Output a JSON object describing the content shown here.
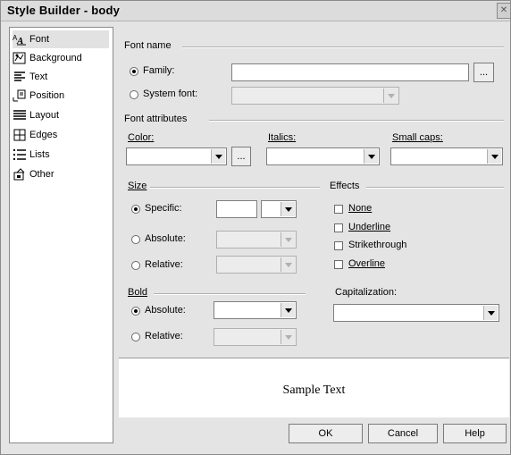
{
  "window": {
    "title": "Style Builder - body"
  },
  "nav": {
    "items": [
      {
        "label": "Font",
        "icon": "font-icon"
      },
      {
        "label": "Background",
        "icon": "background-icon"
      },
      {
        "label": "Text",
        "icon": "text-icon"
      },
      {
        "label": "Position",
        "icon": "position-icon"
      },
      {
        "label": "Layout",
        "icon": "layout-icon"
      },
      {
        "label": "Edges",
        "icon": "edges-icon"
      },
      {
        "label": "Lists",
        "icon": "lists-icon"
      },
      {
        "label": "Other",
        "icon": "other-icon"
      }
    ],
    "selected": "Font"
  },
  "font_name": {
    "header": "Font name",
    "family_label": "Family:",
    "family_value": "",
    "browse_label": "...",
    "system_font_label": "System font:",
    "system_font_value": ""
  },
  "font_attributes": {
    "header": "Font attributes",
    "color_label": "Color:",
    "color_browse_label": "...",
    "italics_label": "Italics:",
    "small_caps_label": "Small caps:"
  },
  "size": {
    "header": "Size",
    "specific_label": "Specific:",
    "absolute_label": "Absolute:",
    "relative_label": "Relative:"
  },
  "effects": {
    "header": "Effects",
    "none_label": "None",
    "underline_label": "Underline",
    "strikethrough_label": "Strikethrough",
    "overline_label": "Overline"
  },
  "bold": {
    "header": "Bold",
    "absolute_label": "Absolute:",
    "relative_label": "Relative:"
  },
  "capitalization": {
    "label": "Capitalization:"
  },
  "preview": {
    "sample_text": "Sample Text"
  },
  "footer": {
    "ok_label": "OK",
    "cancel_label": "Cancel",
    "help_label": "Help"
  }
}
